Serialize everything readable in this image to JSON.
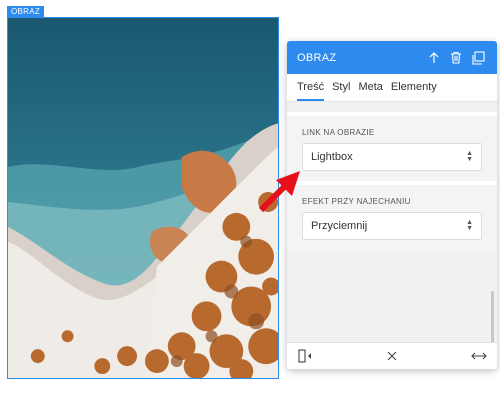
{
  "image": {
    "tag": "OBRAZ",
    "alt_icon": "aerial-coast-photo"
  },
  "panel": {
    "title": "OBRAZ",
    "header_icons": [
      "arrow-up-icon",
      "trash-icon",
      "duplicate-icon"
    ],
    "tabs": [
      {
        "label": "Treść",
        "active": true
      },
      {
        "label": "Styl",
        "active": false
      },
      {
        "label": "Meta",
        "active": false
      },
      {
        "label": "Elementy",
        "active": false
      }
    ],
    "sections": [
      {
        "label": "LINK NA OBRAZIE",
        "value": "Lightbox"
      },
      {
        "label": "EFEKT PRZY NAJECHANIU",
        "value": "Przyciemnij"
      }
    ],
    "footer_icons": [
      "responsive-icon",
      "close-icon",
      "resize-icon"
    ]
  },
  "colors": {
    "accent": "#2d8bf0",
    "arrow": "#e8101a"
  }
}
